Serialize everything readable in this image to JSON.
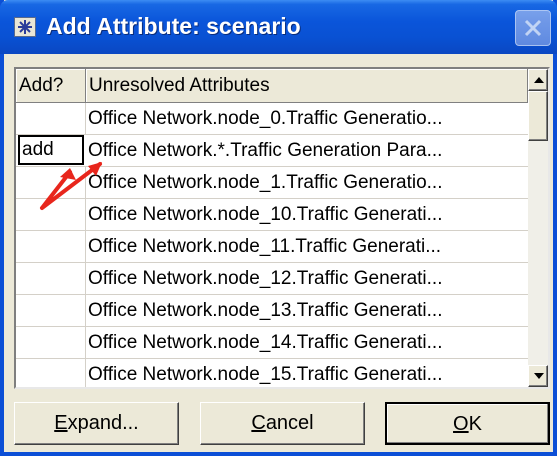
{
  "window": {
    "title": "Add Attribute: scenario",
    "icons": {
      "title": "star-icon",
      "close": "close-icon"
    }
  },
  "table": {
    "columns": [
      "Add?",
      "Unresolved Attributes"
    ],
    "rows": [
      {
        "add": "",
        "attribute": "Office Network.node_0.Traffic Generatio..."
      },
      {
        "add": "add",
        "attribute": "Office Network.*.Traffic Generation Para..."
      },
      {
        "add": "",
        "attribute": "Office Network.node_1.Traffic Generatio..."
      },
      {
        "add": "",
        "attribute": "Office Network.node_10.Traffic Generati..."
      },
      {
        "add": "",
        "attribute": "Office Network.node_11.Traffic Generati..."
      },
      {
        "add": "",
        "attribute": "Office Network.node_12.Traffic Generati..."
      },
      {
        "add": "",
        "attribute": "Office Network.node_13.Traffic Generati..."
      },
      {
        "add": "",
        "attribute": "Office Network.node_14.Traffic Generati..."
      },
      {
        "add": "",
        "attribute": "Office Network.node_15.Traffic Generati..."
      }
    ]
  },
  "buttons": {
    "expand": {
      "mnemonic": "E",
      "rest": "xpand..."
    },
    "cancel": {
      "mnemonic": "C",
      "rest": "ancel"
    },
    "ok": {
      "mnemonic": "O",
      "rest": "K"
    }
  },
  "colors": {
    "titlebar": "#0a55da",
    "annotation_arrow": "#e8261c",
    "dialog_bg": "#ece9d8"
  }
}
